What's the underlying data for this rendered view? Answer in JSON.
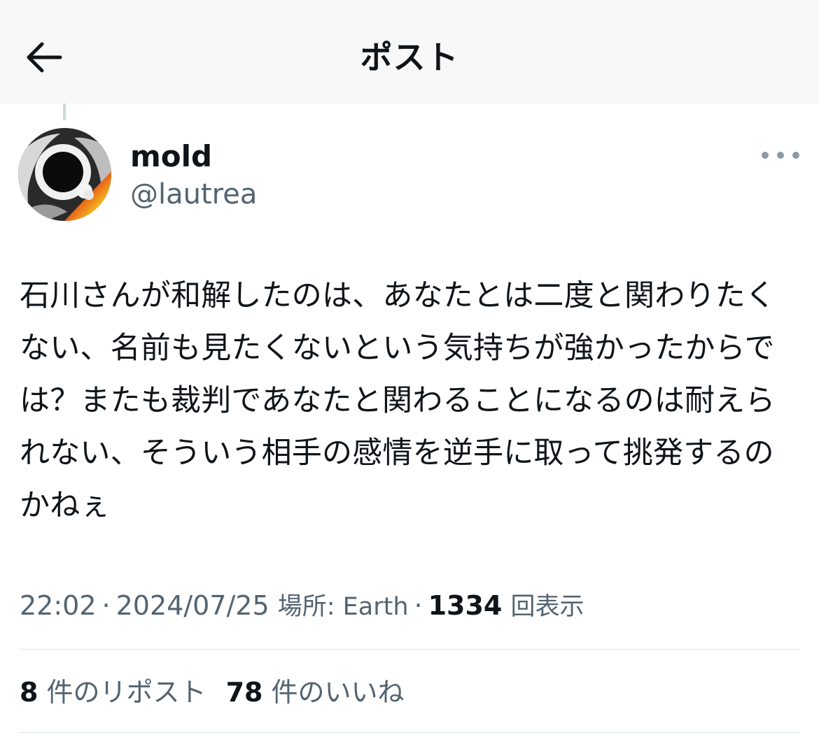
{
  "header": {
    "title": "ポスト",
    "back_icon": "arrow-left-icon"
  },
  "author": {
    "display_name": "mold",
    "handle": "@lautrea",
    "more_icon": "more-horizontal-icon"
  },
  "post": {
    "text": "石川さんが和解したのは、あなたとは二度と関わりたくない、名前も見たくないという気持ちが強かったからでは？またも裁判であなたと関わることになるのは耐えられない、そういう相手の感情を逆手に取って挑発するのかねぇ",
    "time": "22:02",
    "date": "2024/07/25",
    "location": "場所: Earth",
    "views_count": "1334",
    "views_label": "回表示"
  },
  "stats": {
    "reposts_count": "8",
    "reposts_label": "件のリポスト",
    "likes_count": "78",
    "likes_label": "件のいいね"
  },
  "colors": {
    "text_primary": "#0f1419",
    "text_secondary": "#536471",
    "header_bg": "#f8f8f9",
    "divider": "#dde3e7"
  }
}
